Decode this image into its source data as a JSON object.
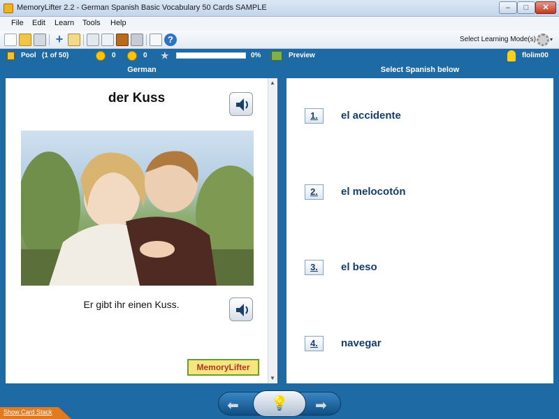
{
  "window": {
    "title": "MemoryLifter 2.2 - German Spanish Basic Vocabulary 50 Cards SAMPLE",
    "min_glyph": "–",
    "max_glyph": "□",
    "close_glyph": "✕"
  },
  "menu": [
    "File",
    "Edit",
    "Learn",
    "Tools",
    "Help"
  ],
  "toolbar": {
    "mode_label": "Select Learning Mode(s)",
    "caret": "▾"
  },
  "status": {
    "pool_label": "Pool",
    "pool_count": "(1 of 50)",
    "right_count": "0",
    "wrong_count": "0",
    "progress_percent": "0%",
    "progress_fraction": 0,
    "preview_label": "Preview",
    "user_name": "flolim00"
  },
  "left": {
    "header": "German",
    "word": "der Kuss",
    "sentence": "Er gibt ihr einen Kuss.",
    "logo_text": "MemoryLifter"
  },
  "right": {
    "header": "Select Spanish below",
    "answers": [
      {
        "num": "1.",
        "text": "el accidente"
      },
      {
        "num": "2.",
        "text": "el melocotón"
      },
      {
        "num": "3.",
        "text": "el beso"
      },
      {
        "num": "4.",
        "text": "navegar"
      }
    ]
  },
  "bottom": {
    "show_stack": "Show Card Stack",
    "prev_glyph": "⬅",
    "next_glyph": "➡",
    "hint_glyph": "💡"
  },
  "colors": {
    "accent": "#1e6aa5",
    "answer_text": "#153c6b",
    "orange_tab": "#e37b1e"
  }
}
